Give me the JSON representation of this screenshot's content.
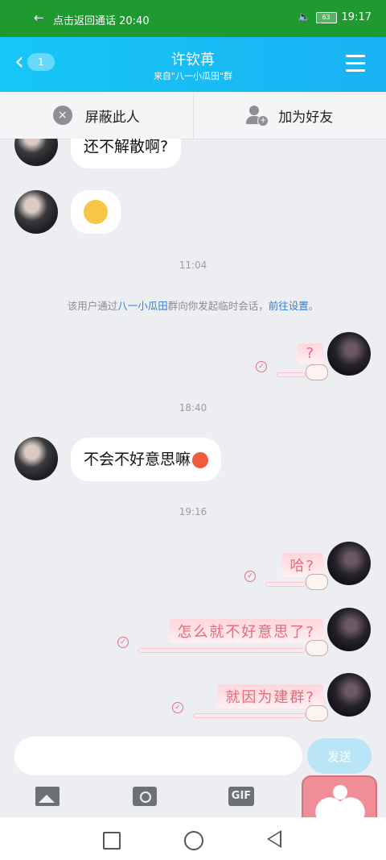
{
  "statusbar": {
    "call_text": "点击返回通话 20:40",
    "battery": "63",
    "time": "19:17"
  },
  "header": {
    "unread_count": "1",
    "title": "许钦苒",
    "subtitle": "来自\"八一小瓜田\"群"
  },
  "actions": {
    "block_label": "屏蔽此人",
    "add_friend_label": "加为好友"
  },
  "messages": {
    "m1": "还不解散啊?",
    "time1": "11:04",
    "system_prefix": "该用户通过",
    "system_group": "八一小瓜田",
    "system_middle": "群向你发起临时会话，",
    "system_link": "前往设置",
    "system_end": "。",
    "sent1": "?",
    "time2": "18:40",
    "m3": "不会不好意思嘛",
    "time3": "19:16",
    "sent2": "哈?",
    "sent3": "怎么就不好意思了?",
    "sent4": "就因为建群?"
  },
  "composer": {
    "send_label": "发送",
    "placeholder": ""
  },
  "toolbar": {
    "gif_label": "GIF"
  }
}
